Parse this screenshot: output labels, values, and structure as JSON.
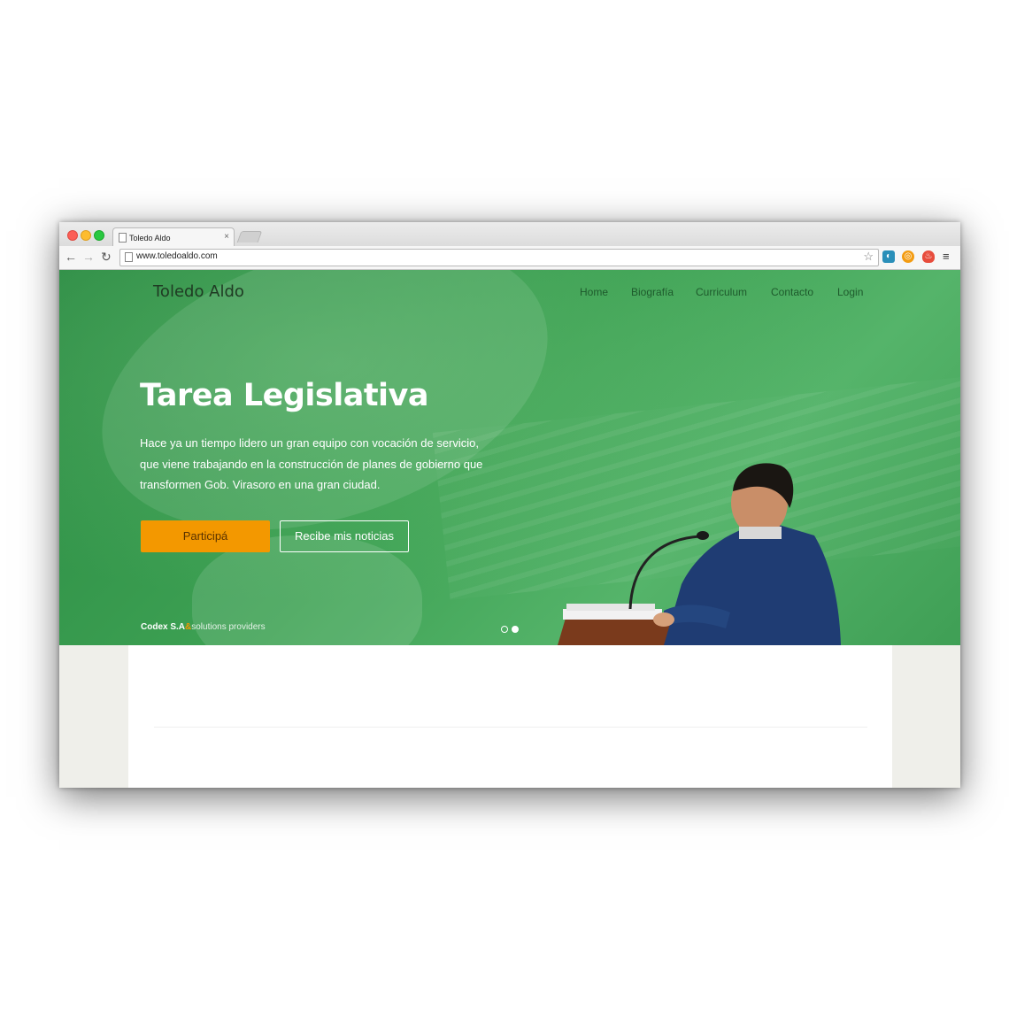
{
  "browser": {
    "tab_title": "Toledo Aldo",
    "tab_close": "×",
    "url": "www.toledoaldo.com",
    "nav_icons": {
      "back": "back-arrow-icon",
      "forward": "forward-arrow-icon",
      "reload": "reload-icon"
    },
    "back_glyph": "←",
    "forward_glyph": "→",
    "reload_glyph": "↻",
    "bookmark_glyph": "☆",
    "menu_glyph": "≡"
  },
  "site": {
    "brand": "Toledo Aldo",
    "nav": [
      "Home",
      "Biografía",
      "Curriculum",
      "Contacto",
      "Login"
    ],
    "hero": {
      "title": "Tarea Legislativa",
      "text": "Hace ya un tiempo lidero un gran equipo con vocación de servicio, que viene trabajando en la construcción de planes de gobierno que transformen Gob. Virasoro en una gran ciudad.",
      "primary_button": "Participá",
      "secondary_button": "Recibe mis noticias",
      "slide_count": 2,
      "active_slide": 2
    },
    "footer_credit": {
      "company": "Codex S.A",
      "amp": "&",
      "tagline": "solutions providers"
    }
  },
  "colors": {
    "hero_green": "#3ea254",
    "accent_orange": "#f39800",
    "nav_text": "#1e5a2c",
    "page_bg": "#efefea"
  }
}
